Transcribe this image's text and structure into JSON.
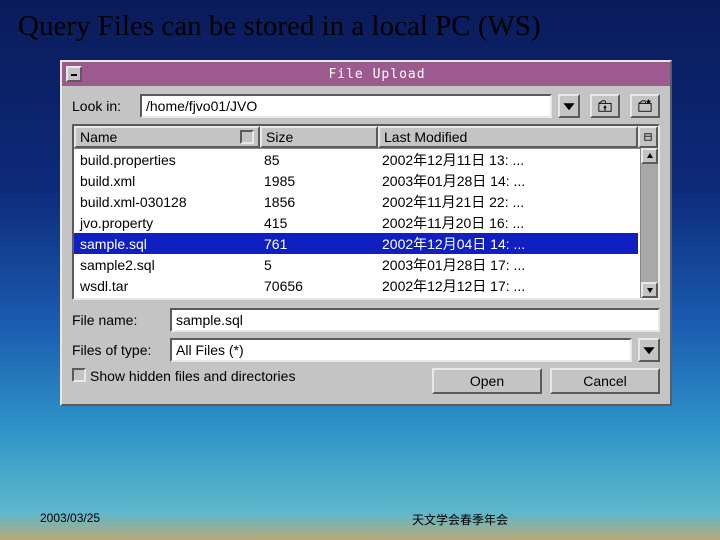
{
  "slide": {
    "title": "Query Files can be stored in a local PC (WS)"
  },
  "dialog": {
    "title": "File Upload",
    "look_in_label": "Look in:",
    "look_in_path": "/home/fjvo01/JVO",
    "columns": {
      "name": "Name",
      "size": "Size",
      "modified": "Last Modified"
    },
    "files": [
      {
        "name": "build.properties",
        "size": "85",
        "modified": "2002年12月11日 13: ...",
        "selected": false
      },
      {
        "name": "build.xml",
        "size": "1985",
        "modified": "2003年01月28日 14: ...",
        "selected": false
      },
      {
        "name": "build.xml-030128",
        "size": "1856",
        "modified": "2002年11月21日 22: ...",
        "selected": false
      },
      {
        "name": "jvo.property",
        "size": "415",
        "modified": "2002年11月20日 16: ...",
        "selected": false
      },
      {
        "name": "sample.sql",
        "size": "761",
        "modified": "2002年12月04日 14: ...",
        "selected": true
      },
      {
        "name": "sample2.sql",
        "size": "5",
        "modified": "2003年01月28日 17: ...",
        "selected": false
      },
      {
        "name": "wsdl.tar",
        "size": "70656",
        "modified": "2002年12月12日 17: ...",
        "selected": false
      }
    ],
    "file_name_label": "File name:",
    "file_name_value": "sample.sql",
    "files_type_label": "Files of type:",
    "files_type_value": "All Files (*)",
    "show_hidden_label": "Show hidden files and directories",
    "open_label": "Open",
    "cancel_label": "Cancel"
  },
  "footer": {
    "date": "2003/03/25",
    "center": "天文学会春季年会"
  }
}
